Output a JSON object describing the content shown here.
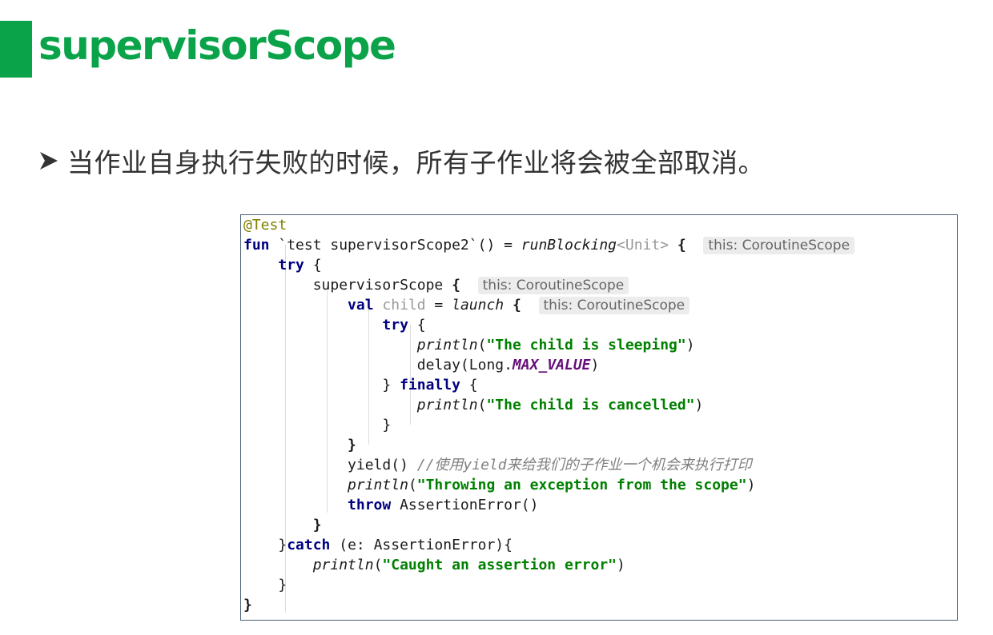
{
  "title": "supervisorScope",
  "bullet": "当作业自身执行失败的时候，所有子作业将会被全部取消。",
  "colors": {
    "accent": "#0aa34a",
    "border": "#4a5f78"
  },
  "icons": {
    "bullet": "arrow-bullet-icon"
  },
  "code": {
    "annotation": "@Test",
    "fun_kw": "fun",
    "fun_name": " `test supervisorScope2`() = ",
    "run_blocking": "runBlocking",
    "type_param": "<Unit>",
    "open_brace": " {",
    "hint_scope": "this: CoroutineScope",
    "try_kw": "try",
    "try_open": " {",
    "supervisor_call": "supervisorScope",
    "val_kw": "val",
    "child_var": " child",
    "assign": " = ",
    "launch_call": "launch",
    "inner_try_kw": "try",
    "println_fn": "println",
    "str_sleeping": "\"The child is sleeping\"",
    "delay_call": "delay(Long.",
    "max_value": "MAX_VALUE",
    "close_paren": ")",
    "close_brace": "}",
    "finally_kw": "finally",
    "str_cancelled": "\"The child is cancelled\"",
    "yield_call": "yield() ",
    "comment": "//使用yield来给我们的子作业一个机会来执行打印",
    "str_throwing": "\"Throwing an exception from the scope\"",
    "throw_kw": "throw",
    "assertion_ctor": " AssertionError()",
    "catch_kw": "catch",
    "catch_params": " (e: AssertionError){",
    "str_caught": "\"Caught an assertion error\""
  }
}
